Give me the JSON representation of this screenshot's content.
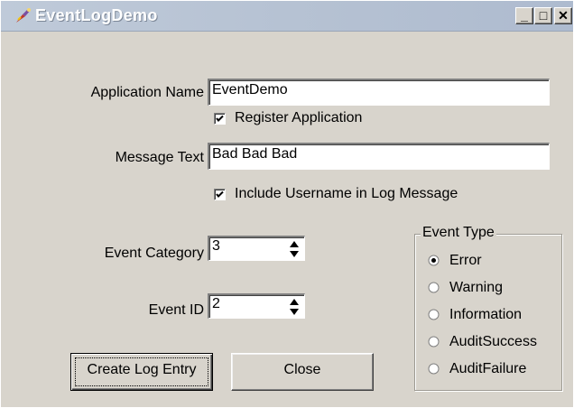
{
  "window": {
    "title": "EventLogDemo"
  },
  "titlebar_buttons": {
    "minimize": "_",
    "maximize": "□",
    "close": "✕"
  },
  "form": {
    "app_name_label": "Application Name",
    "app_name_value": "EventDemo",
    "register_label": "Register Application",
    "register_checked": true,
    "message_label": "Message Text",
    "message_value": "Bad Bad Bad",
    "include_user_label": "Include Username in Log Message",
    "include_user_checked": true,
    "category_label": "Event Category",
    "category_value": "3",
    "event_id_label": "Event ID",
    "event_id_value": "2"
  },
  "event_type": {
    "title": "Event Type",
    "options": [
      "Error",
      "Warning",
      "Information",
      "AuditSuccess",
      "AuditFailure"
    ],
    "selected": "Error"
  },
  "buttons": {
    "create": "Create Log Entry",
    "close": "Close"
  }
}
